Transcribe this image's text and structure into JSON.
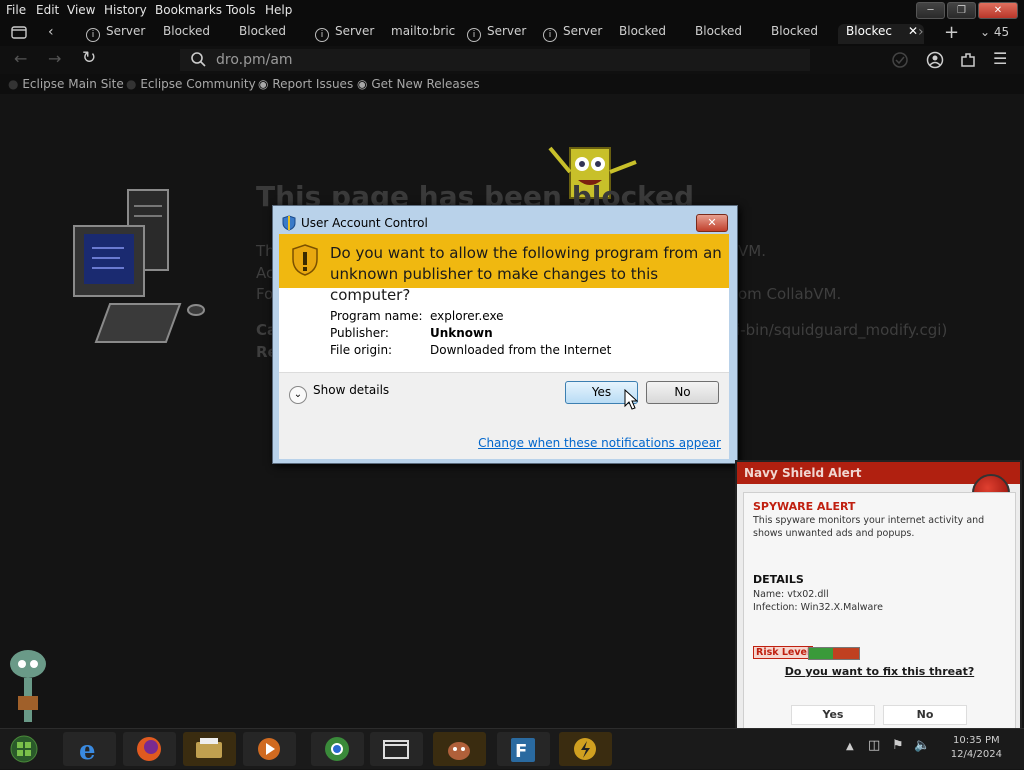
{
  "menubar": {
    "items": [
      "File",
      "Edit",
      "View",
      "History",
      "Bookmarks",
      "Tools",
      "Help"
    ],
    "window_controls": [
      "minimize",
      "maximize",
      "close"
    ]
  },
  "tabs": {
    "items": [
      {
        "label": "Server",
        "icon": "info-icon"
      },
      {
        "label": "Blocked",
        "icon": ""
      },
      {
        "label": "Blocked",
        "icon": ""
      },
      {
        "label": "Server",
        "icon": "info-icon"
      },
      {
        "label": "mailto:bric",
        "icon": ""
      },
      {
        "label": "Server",
        "icon": "info-icon"
      },
      {
        "label": "Server",
        "icon": "info-icon"
      },
      {
        "label": "Blocked",
        "icon": ""
      },
      {
        "label": "Blocked",
        "icon": ""
      },
      {
        "label": "Blocked",
        "icon": ""
      },
      {
        "label": "Blockec",
        "icon": ""
      }
    ],
    "tab_count": "45"
  },
  "navbar": {
    "url": "dro.pm/am"
  },
  "bookmarks": {
    "items": [
      {
        "label": "Eclipse Main Site"
      },
      {
        "label": "Eclipse Community"
      },
      {
        "label": "Report Issues"
      },
      {
        "label": "Get New Releases"
      }
    ]
  },
  "page": {
    "title": "This page has been blocked",
    "lines": [
      {
        "lead": "Th",
        "tail": "VM."
      },
      {
        "lead": "Ac",
        "tail": ""
      },
      {
        "lead": "Fo",
        "tail": "om CollabVM."
      },
      {
        "lead": "Ca",
        "tail": "i-bin/squidguard_modify.cgi)"
      },
      {
        "lead": "Re",
        "tail": ""
      }
    ]
  },
  "uac": {
    "title": "User Account Control",
    "question": "Do you want to allow the following program from an unknown publisher to make changes to this computer?",
    "program_name_label": "Program name:",
    "program_name": "explorer.exe",
    "publisher_label": "Publisher:",
    "publisher": "Unknown",
    "file_origin_label": "File origin:",
    "file_origin": "Downloaded from the Internet",
    "show_details": "Show details",
    "yes": "Yes",
    "no": "No",
    "change_link": "Change when these notifications appear"
  },
  "spyware": {
    "title": "Navy Shield Alert",
    "alert": "SPYWARE ALERT",
    "desc1": "This spyware monitors your internet activity and",
    "desc2": "shows unwanted ads and popups.",
    "details_heading": "DETAILS",
    "name": "Name: vtx02.dll",
    "infection": "Infection: Win32.X.Malware",
    "risk_label": "Risk Level",
    "question": "Do you want to fix this threat?",
    "yes": "Yes",
    "no": "No"
  },
  "taskbar": {
    "apps": [
      "internet-explorer-icon",
      "firefox-icon",
      "printer-icon",
      "media-player-icon",
      "chrome-icon",
      "window-icon",
      "gimp-icon",
      "filezilla-icon",
      "power-icon"
    ],
    "time": "10:35 PM",
    "date": "12/4/2024"
  }
}
